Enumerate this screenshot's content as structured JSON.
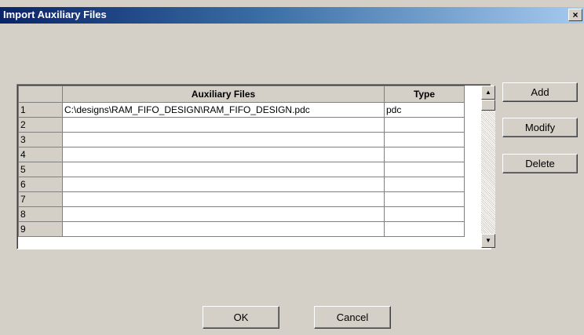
{
  "window": {
    "title": "Import Auxiliary Files",
    "close_label": "×"
  },
  "table": {
    "columns": {
      "num": "",
      "files": "Auxiliary Files",
      "type": "Type"
    },
    "rows": [
      {
        "num": "1",
        "file": "C:\\designs\\RAM_FIFO_DESIGN\\RAM_FIFO_DESIGN.pdc",
        "type": "pdc"
      },
      {
        "num": "2",
        "file": "",
        "type": ""
      },
      {
        "num": "3",
        "file": "",
        "type": ""
      },
      {
        "num": "4",
        "file": "",
        "type": ""
      },
      {
        "num": "5",
        "file": "",
        "type": ""
      },
      {
        "num": "6",
        "file": "",
        "type": ""
      },
      {
        "num": "7",
        "file": "",
        "type": ""
      },
      {
        "num": "8",
        "file": "",
        "type": ""
      },
      {
        "num": "9",
        "file": "",
        "type": ""
      }
    ]
  },
  "scrollbar": {
    "up_icon": "▲",
    "down_icon": "▼"
  },
  "side_buttons": {
    "add": "Add",
    "modify": "Modify",
    "delete": "Delete"
  },
  "bottom_buttons": {
    "ok": "OK",
    "cancel": "Cancel"
  }
}
